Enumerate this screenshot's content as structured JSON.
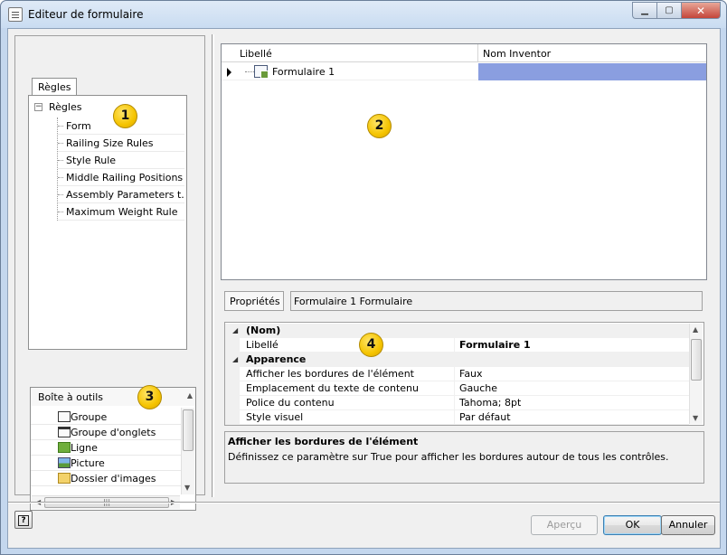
{
  "window": {
    "title": "Editeur de formulaire",
    "controls": {
      "minimize_icon": "minimize-icon",
      "maximize_icon": "maximize-icon",
      "close_icon": "close-icon"
    }
  },
  "left": {
    "tab_label": "Règles",
    "tree": {
      "root_label": "Règles",
      "items": [
        {
          "label": "Form"
        },
        {
          "label": "Railing Size Rules"
        },
        {
          "label": "Style Rule"
        },
        {
          "label": "Middle Railing Positions"
        },
        {
          "label": "Assembly Parameters t..."
        },
        {
          "label": "Maximum Weight Rule"
        }
      ]
    },
    "toolbox": {
      "title": "Boîte à outils",
      "items": [
        {
          "label": "Groupe",
          "icon": "group-icon"
        },
        {
          "label": "Groupe d'onglets",
          "icon": "tab-group-icon"
        },
        {
          "label": "Ligne",
          "icon": "row-icon"
        },
        {
          "label": "Picture",
          "icon": "picture-icon"
        },
        {
          "label": "Dossier d'images",
          "icon": "picture-folder-icon"
        }
      ]
    }
  },
  "grid": {
    "columns": [
      "Libellé",
      "Nom Inventor"
    ],
    "rows": [
      {
        "label": "Formulaire 1",
        "inventor_name": ""
      }
    ]
  },
  "properties": {
    "tab_label": "Propriétés",
    "object_title": "Formulaire 1 Formulaire",
    "rows": [
      {
        "type": "category",
        "label": "(Nom)"
      },
      {
        "type": "item",
        "name": "Libellé",
        "value": "Formulaire 1",
        "bold": true
      },
      {
        "type": "category",
        "label": "Apparence"
      },
      {
        "type": "item",
        "name": "Afficher les bordures de l'élément",
        "value": "Faux"
      },
      {
        "type": "item",
        "name": "Emplacement du texte de contenu",
        "value": "Gauche"
      },
      {
        "type": "item",
        "name": "Police du contenu",
        "value": "Tahoma; 8pt"
      },
      {
        "type": "item",
        "name": "Style visuel",
        "value": "Par défaut"
      }
    ],
    "description": {
      "title": "Afficher les bordures de l'élément",
      "text": "Définissez ce paramètre sur True pour afficher les bordures autour de tous les contrôles."
    }
  },
  "callouts": [
    "1",
    "2",
    "3",
    "4"
  ],
  "buttons": {
    "help": "?",
    "apply": "Aperçu",
    "ok": "OK",
    "cancel": "Annuler"
  },
  "colors": {
    "selection": "#8a9ee0",
    "callout": "#f5c400",
    "frame": "#c4d7ee"
  }
}
